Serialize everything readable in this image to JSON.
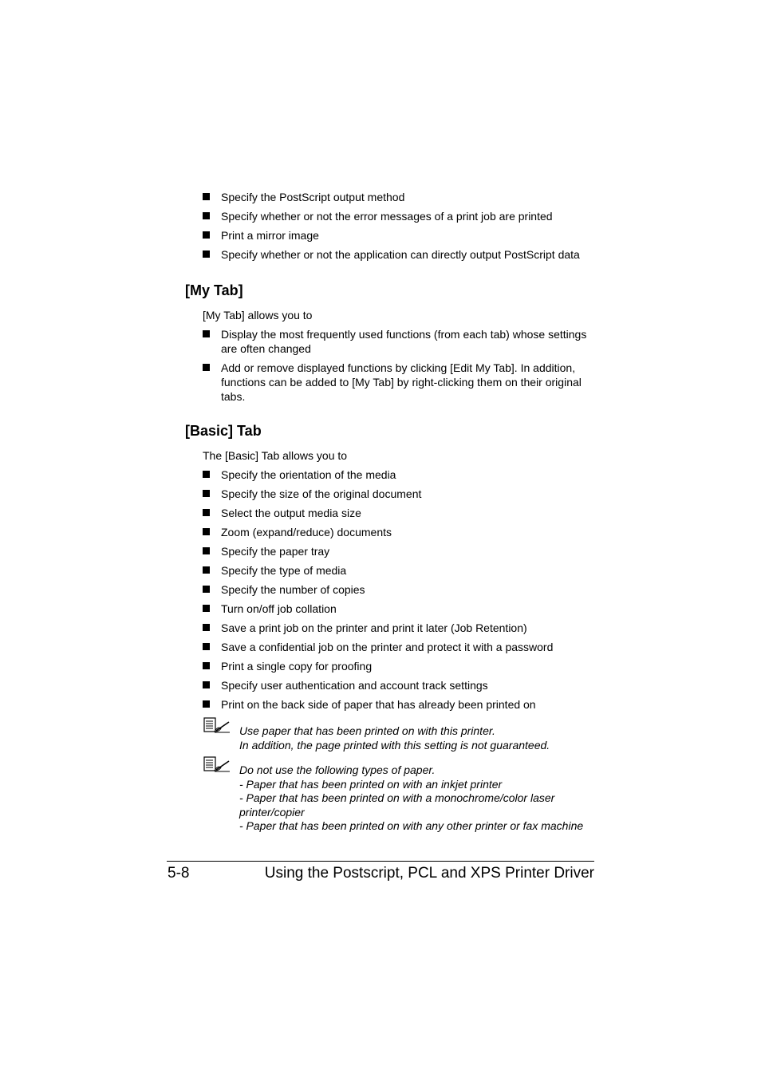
{
  "top_list": {
    "items": [
      "Specify the PostScript output method",
      "Specify whether or not the error messages of a print job are printed",
      "Print a mirror image",
      "Specify whether or not the application can directly output PostScript data"
    ]
  },
  "my_tab": {
    "heading": "[My Tab]",
    "intro": "[My Tab] allows you to",
    "items": [
      "Display the most frequently used functions (from each tab) whose settings are often changed",
      "Add or remove displayed functions by clicking [Edit My Tab]. In addition, functions can be added to [My Tab] by right-clicking them on their original tabs."
    ]
  },
  "basic_tab": {
    "heading": "[Basic] Tab",
    "intro": "The [Basic] Tab allows you to",
    "items": [
      "Specify the orientation of the media",
      "Specify the size of the original document",
      "Select the output media size",
      "Zoom (expand/reduce) documents",
      "Specify the paper tray",
      "Specify the type of media",
      "Specify the number of copies",
      "Turn on/off job collation",
      "Save a print job on the printer and print it later (Job Retention)",
      "Save a confidential job on the printer and protect it with a password",
      "Print a single copy for proofing",
      "Specify user authentication and account track settings",
      "Print on the back side of paper that has already been printed on"
    ]
  },
  "notes": [
    {
      "icon": "note-pencil-icon",
      "lines": [
        "Use paper that has been printed on with this printer.",
        "In addition, the page printed with this setting is not guaranteed."
      ]
    },
    {
      "icon": "note-pencil-icon",
      "lines": [
        "Do not use the following types of paper.",
        "- Paper that has been printed on with an inkjet printer",
        "- Paper that has been printed on with a monochrome/color laser printer/copier",
        "- Paper that has been printed on with any other printer or fax machine"
      ]
    }
  ],
  "footer": {
    "page_number": "5-8",
    "title": "Using the Postscript, PCL and XPS Printer Driver"
  }
}
